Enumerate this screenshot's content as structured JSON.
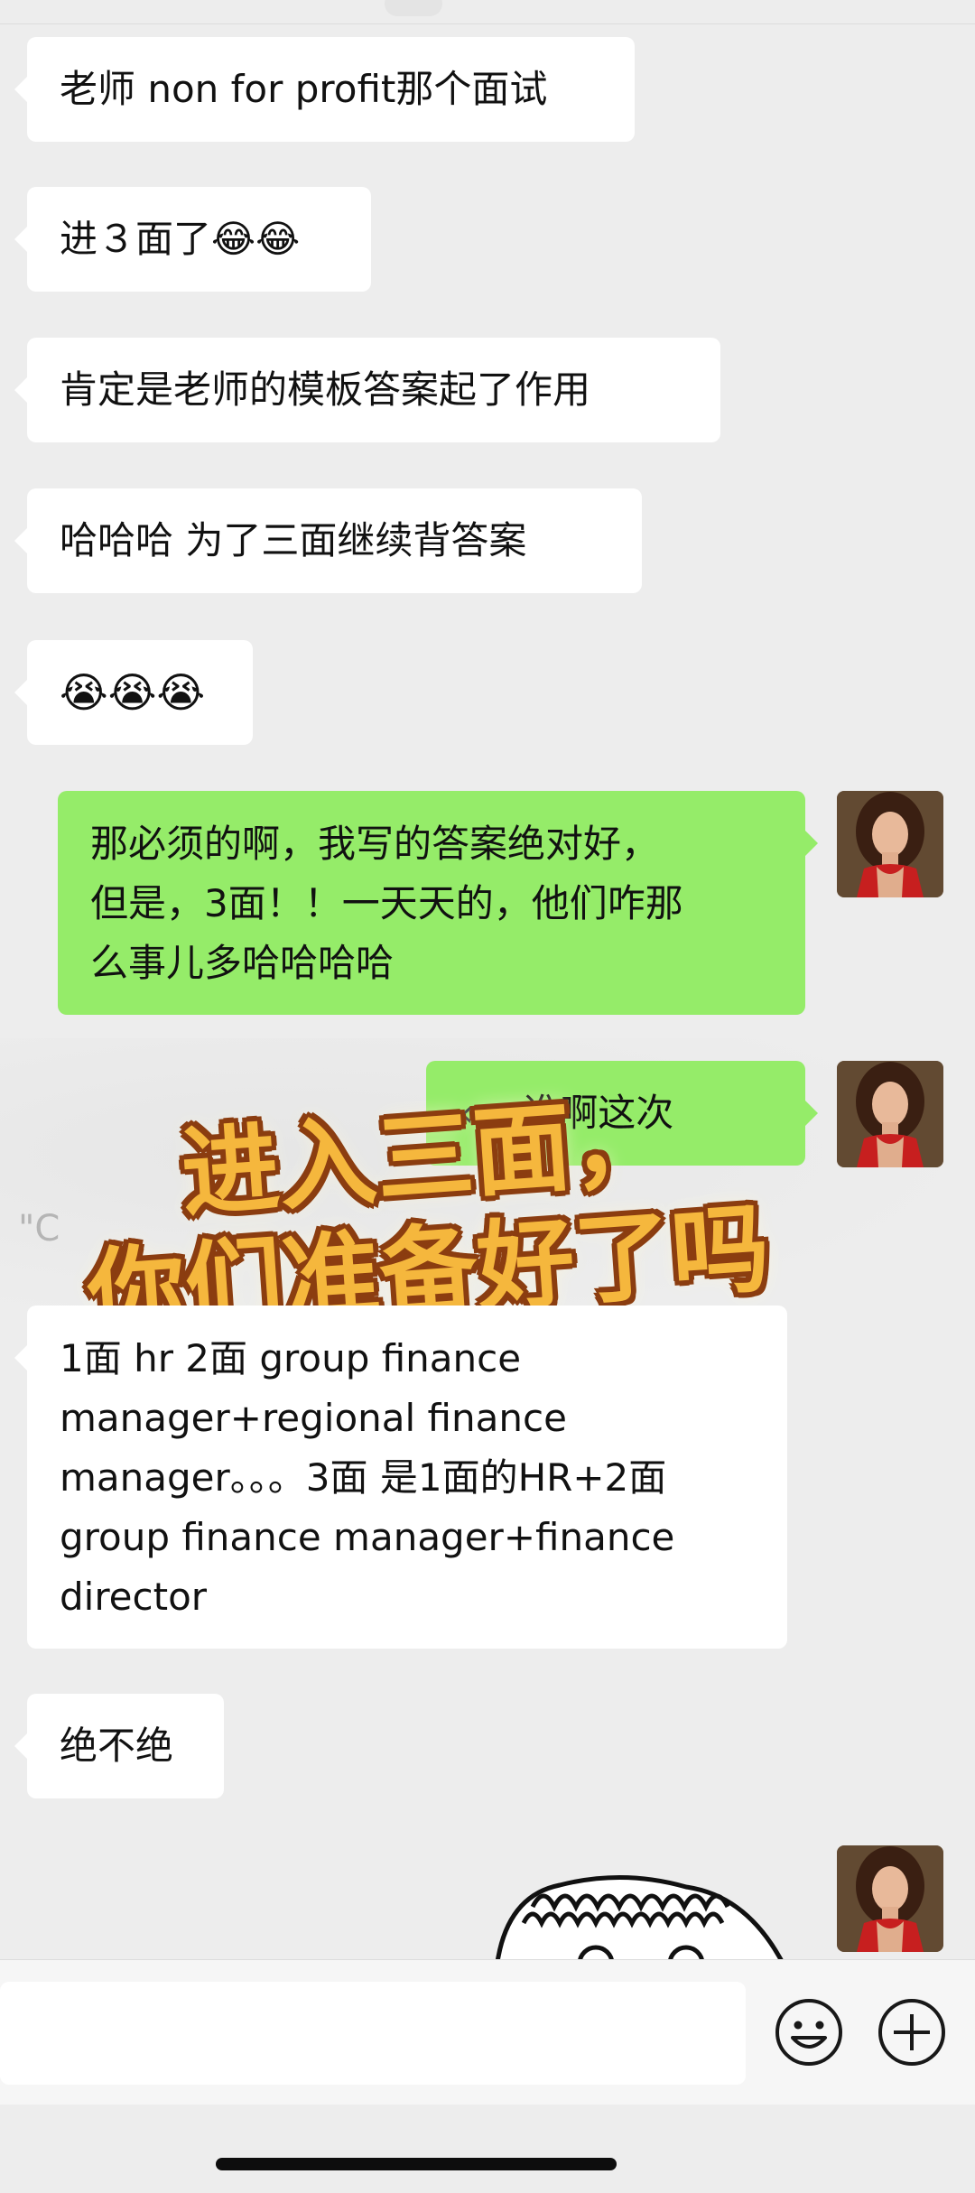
{
  "messages": [
    {
      "side": "in",
      "text": "老师 non for profit那个面试"
    },
    {
      "side": "in",
      "text": "进３面了😂😂"
    },
    {
      "side": "in",
      "text": "肯定是老师的模板答案起了作用"
    },
    {
      "side": "in",
      "text": "哈哈哈 为了三面继续背答案"
    },
    {
      "side": "in",
      "text": "😭😭😭"
    },
    {
      "side": "out",
      "lines": [
        "那必须的啊，我写的答案绝对好，",
        "但是，3面！！一天天的，他们咋那",
        "么事儿多哈哈哈哈"
      ]
    },
    {
      "side": "out",
      "text": "谁啊这次"
    },
    {
      "side": "in",
      "lines": [
        "1面 hr 2面 group finance",
        "manager+regional finance",
        "manager。。。3面 是1面的HR+2面",
        "group finance manager+finance",
        "director"
      ]
    },
    {
      "side": "in",
      "text": "绝不绝"
    }
  ],
  "overlay": {
    "line1": "进入三面，",
    "line2": "你们准备好了吗"
  },
  "faded_quote": "\"C"
}
